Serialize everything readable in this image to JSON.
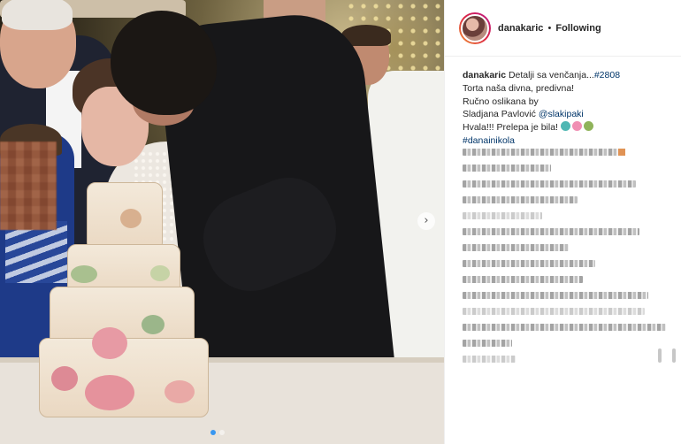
{
  "post": {
    "username": "danakaric",
    "follow_status": "Following",
    "separator": "•",
    "caption": {
      "username": "danakaric",
      "line1_text": "Detalji sa venčanja...",
      "line1_tag": "#2808",
      "line2": "Torta naša divna, predivna!",
      "line3": "Ručno oslikana by",
      "line4_text": "Sladjana Pavlović",
      "line4_mention": "@slakipaki",
      "line5_text": "Hvala!!! Prelepa je bila!",
      "line6_tag": "#danainikola"
    },
    "emoji_icons": [
      "unicorn-icon",
      "blossom-icon",
      "cake-icon"
    ],
    "carousel": {
      "next_glyph": "›",
      "active_index": 0,
      "count": 2
    }
  },
  "comments": {
    "blurred": true,
    "rows": 14
  },
  "colors": {
    "accent_blue": "#3897f0",
    "link_blue": "#003569",
    "text": "#262626",
    "border": "#efefef"
  }
}
